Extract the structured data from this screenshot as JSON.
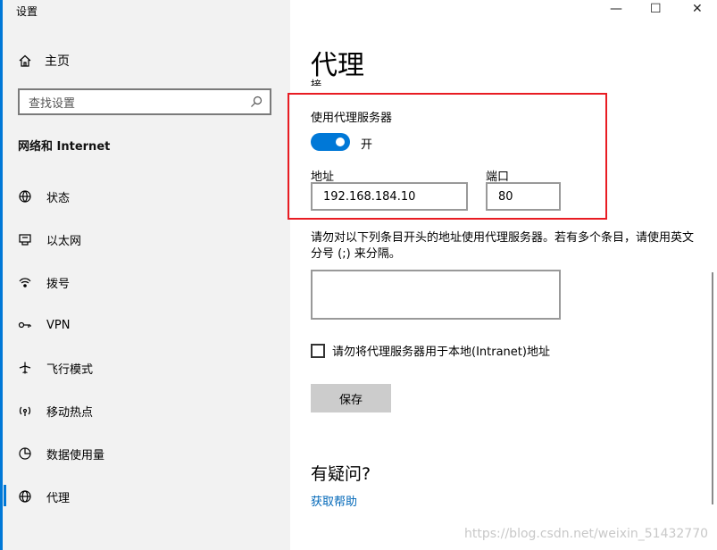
{
  "window": {
    "title": "设置",
    "minimize_glyph": "—",
    "maximize_glyph": "☐",
    "close_glyph": "✕"
  },
  "sidebar": {
    "home_label": "主页",
    "search": {
      "placeholder": "查找设置"
    },
    "section_title": "网络和 Internet",
    "items": [
      {
        "label": "状态",
        "icon": "status-icon"
      },
      {
        "label": "以太网",
        "icon": "ethernet-icon"
      },
      {
        "label": "拨号",
        "icon": "dialup-icon"
      },
      {
        "label": "VPN",
        "icon": "vpn-icon"
      },
      {
        "label": "飞行模式",
        "icon": "airplane-icon"
      },
      {
        "label": "移动热点",
        "icon": "hotspot-icon"
      },
      {
        "label": "数据使用量",
        "icon": "data-usage-icon"
      },
      {
        "label": "代理",
        "icon": "proxy-globe-icon",
        "active": true
      }
    ]
  },
  "main": {
    "title": "代理",
    "cut_off_text": "接",
    "manual_proxy": {
      "use_proxy_label": "使用代理服务器",
      "toggle_state": "开",
      "address_label": "地址",
      "address_value": "192.168.184.10",
      "port_label": "端口",
      "port_value": "80"
    },
    "exception_desc": "请勿对以下列条目开头的地址使用代理服务器。若有多个条目，请使用英文分号 (;) 来分隔。",
    "exception_value": "",
    "local_checkbox_label": "请勿将代理服务器用于本地(Intranet)地址",
    "save_label": "保存",
    "question_title": "有疑问?",
    "help_link": "获取帮助"
  },
  "watermark": "https://blog.csdn.net/weixin_51432770",
  "colors": {
    "accent": "#0078d7",
    "highlight_box": "#e81c23",
    "link": "#0067b8"
  }
}
